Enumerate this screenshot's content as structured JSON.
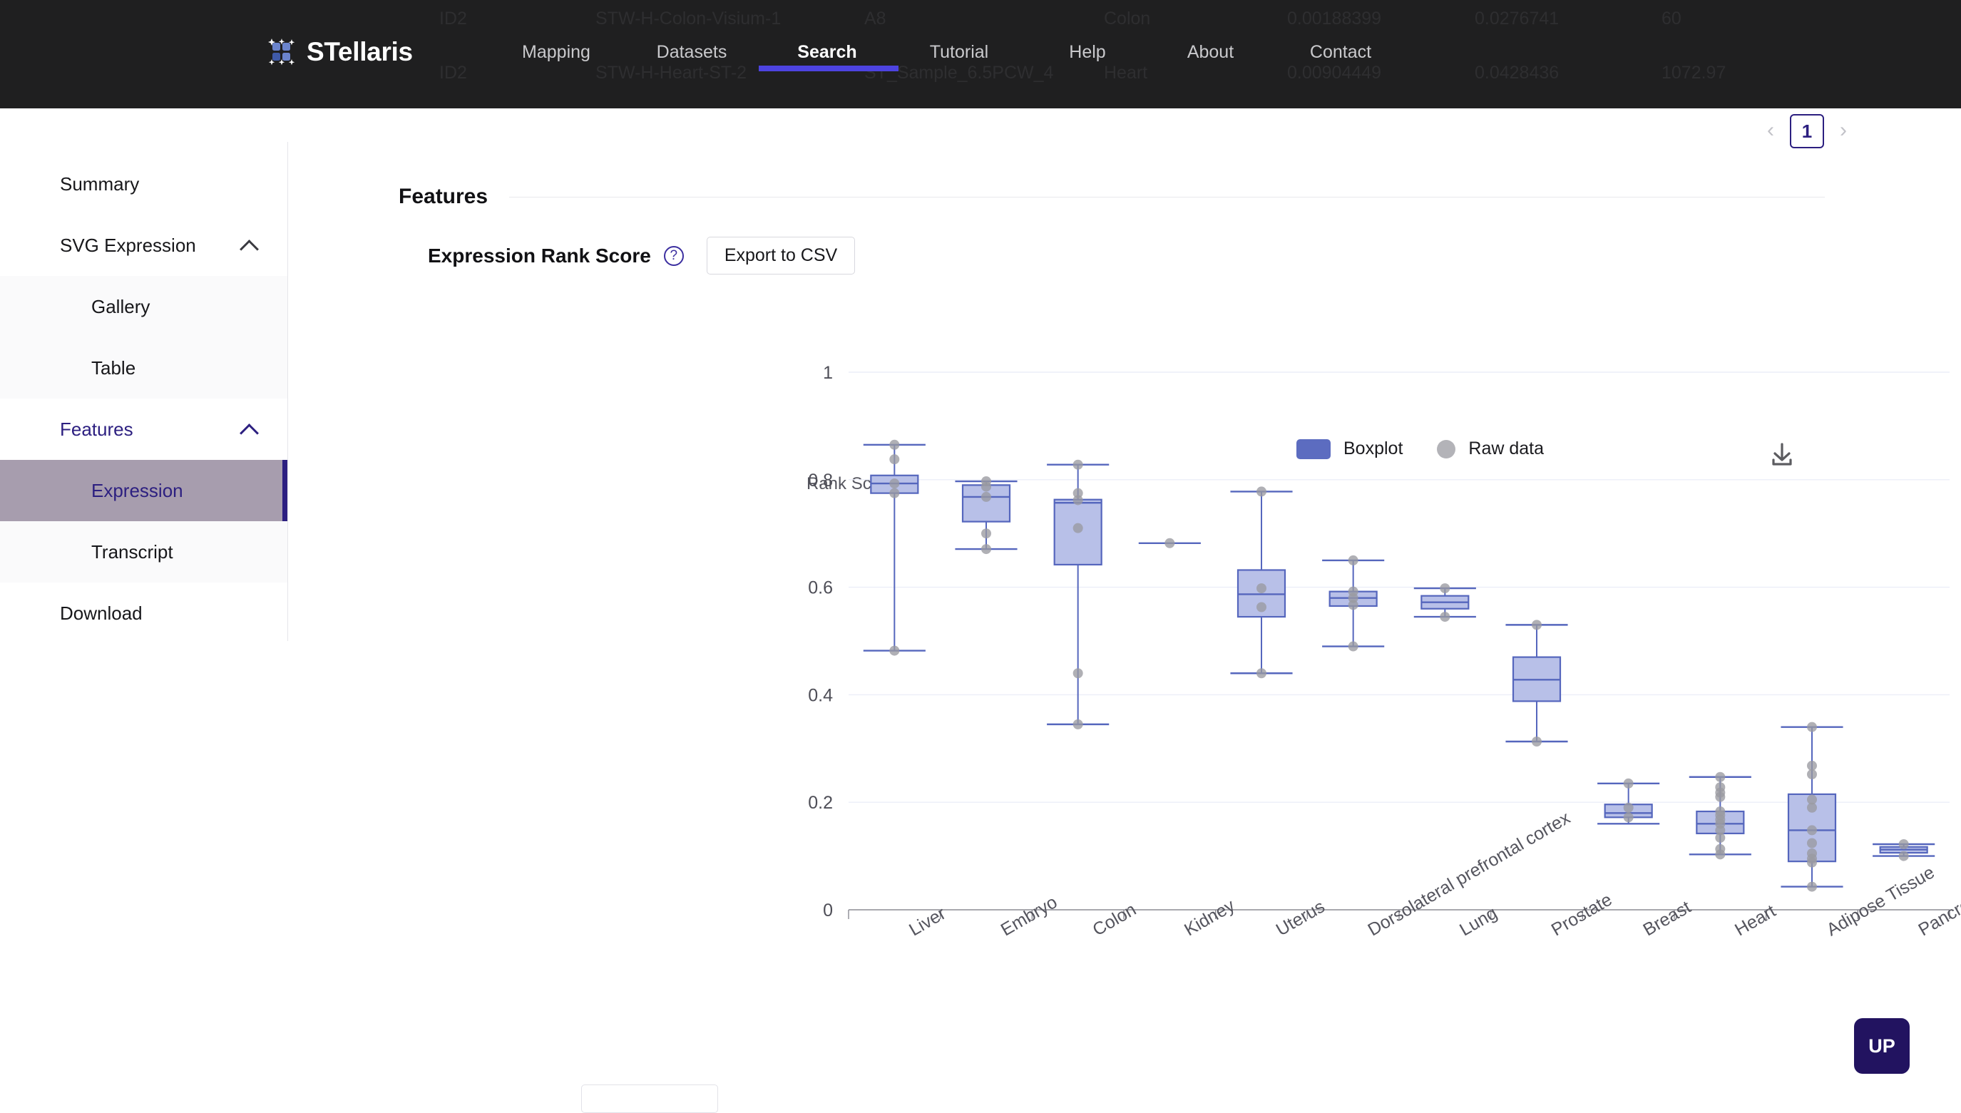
{
  "header": {
    "brand": "STellaris",
    "logo_icon": "grid-sparkle-logo-icon",
    "nav": [
      {
        "label": "Mapping",
        "active": false
      },
      {
        "label": "Datasets",
        "active": false
      },
      {
        "label": "Search",
        "active": true
      },
      {
        "label": "Tutorial",
        "active": false
      },
      {
        "label": "Help",
        "active": false
      },
      {
        "label": "About",
        "active": false
      },
      {
        "label": "Contact",
        "active": false
      }
    ],
    "accent_underline_color": "#4d43e0",
    "background_color": "#1f1f20",
    "ghost_rows": [
      [
        "ID2",
        "STW-H-Colon-Visium-1",
        "A8",
        "Colon",
        "0.00188399",
        "0.0276741",
        "60"
      ],
      [
        "ID2",
        "STW-H-Heart-ST-2",
        "ST_Sample_6.5PCW_4",
        "Heart",
        "0.00904449",
        "0.0428436",
        "1072.97"
      ]
    ]
  },
  "pagination": {
    "prev_icon": "chevron-left-icon",
    "next_icon": "chevron-right-icon",
    "current_page": "1"
  },
  "sidebar": {
    "items": [
      {
        "label": "Summary",
        "type": "item"
      },
      {
        "label": "SVG Expression",
        "type": "group",
        "expanded": true,
        "chevron": "chevron-up-icon"
      },
      {
        "label": "Gallery",
        "type": "sub"
      },
      {
        "label": "Table",
        "type": "sub"
      },
      {
        "label": "Features",
        "type": "group",
        "expanded": true,
        "chevron": "chevron-up-icon"
      },
      {
        "label": "Expression",
        "type": "sub",
        "selected": true
      },
      {
        "label": "Transcript",
        "type": "sub"
      },
      {
        "label": "Download",
        "type": "item"
      }
    ],
    "selected_bg": "#a79dae",
    "selected_accent": "#2c1f80"
  },
  "main": {
    "section_title": "Features",
    "panel_title": "Expression Rank Score",
    "help_icon": "question-mark-circle-icon",
    "export_button": "Export to CSV",
    "download_icon": "download-icon",
    "scroll_top_button": "UP"
  },
  "legend": {
    "boxplot_label": "Boxplot",
    "boxplot_color": "#5c6cc0",
    "rawdata_label": "Raw data",
    "rawdata_color": "#b3b3b8"
  },
  "chart_data": {
    "type": "box",
    "title": "Expression Rank Score",
    "xlabel": "",
    "ylabel": "Rank Score",
    "ylim": [
      0,
      1
    ],
    "ytick_labels": [
      "1",
      "0.8",
      "0.6",
      "0.4",
      "0.2",
      "0"
    ],
    "ytick_values": [
      1,
      0.8,
      0.6,
      0.4,
      0.2,
      0
    ],
    "grid": true,
    "legend_position": "top-center",
    "xtick_rotation": -30,
    "box_fill": "#b8c0e8",
    "box_stroke": "#5566bd",
    "point_color": "#9a9aa0",
    "categories": [
      "Liver",
      "Embryo",
      "Colon",
      "Kidney",
      "Uterus",
      "Dorsolateral prefrontal cortex",
      "Lung",
      "Prostate",
      "Breast",
      "Heart",
      "Adipose Tissue",
      "Pancreas"
    ],
    "boxes": [
      {
        "category": "Liver",
        "min": 0.482,
        "q1": 0.775,
        "median": 0.793,
        "q3": 0.808,
        "max": 0.865,
        "points": [
          0.865,
          0.838,
          0.793,
          0.775,
          0.482
        ]
      },
      {
        "category": "Embryo",
        "min": 0.671,
        "q1": 0.722,
        "median": 0.768,
        "q3": 0.79,
        "max": 0.797,
        "points": [
          0.797,
          0.787,
          0.768,
          0.7,
          0.671
        ]
      },
      {
        "category": "Colon",
        "min": 0.345,
        "q1": 0.642,
        "median": 0.757,
        "q3": 0.763,
        "max": 0.828,
        "points": [
          0.828,
          0.775,
          0.762,
          0.71,
          0.44,
          0.345
        ]
      },
      {
        "category": "Kidney",
        "min": 0.682,
        "q1": 0.682,
        "median": 0.682,
        "q3": 0.682,
        "max": 0.682,
        "points": [
          0.682
        ]
      },
      {
        "category": "Uterus",
        "min": 0.44,
        "q1": 0.545,
        "median": 0.587,
        "q3": 0.632,
        "max": 0.778,
        "points": [
          0.778,
          0.598,
          0.563,
          0.44
        ]
      },
      {
        "category": "Dorsolateral prefrontal cortex",
        "min": 0.49,
        "q1": 0.565,
        "median": 0.58,
        "q3": 0.592,
        "max": 0.65,
        "points": [
          0.65,
          0.592,
          0.58,
          0.567,
          0.49
        ]
      },
      {
        "category": "Lung",
        "min": 0.545,
        "q1": 0.56,
        "median": 0.572,
        "q3": 0.584,
        "max": 0.598,
        "points": [
          0.598,
          0.545
        ]
      },
      {
        "category": "Prostate",
        "min": 0.313,
        "q1": 0.388,
        "median": 0.428,
        "q3": 0.47,
        "max": 0.53,
        "points": [
          0.53,
          0.313
        ]
      },
      {
        "category": "Breast",
        "min": 0.16,
        "q1": 0.172,
        "median": 0.18,
        "q3": 0.196,
        "max": 0.235,
        "points": [
          0.235,
          0.19,
          0.172
        ]
      },
      {
        "category": "Heart",
        "min": 0.103,
        "q1": 0.142,
        "median": 0.16,
        "q3": 0.183,
        "max": 0.247,
        "points": [
          0.247,
          0.228,
          0.218,
          0.21,
          0.183,
          0.176,
          0.168,
          0.16,
          0.148,
          0.134,
          0.113,
          0.103
        ]
      },
      {
        "category": "Adipose Tissue",
        "min": 0.043,
        "q1": 0.09,
        "median": 0.148,
        "q3": 0.215,
        "max": 0.34,
        "points": [
          0.34,
          0.268,
          0.252,
          0.205,
          0.19,
          0.148,
          0.124,
          0.105,
          0.095,
          0.088,
          0.043
        ]
      },
      {
        "category": "Pancreas",
        "min": 0.1,
        "q1": 0.106,
        "median": 0.112,
        "q3": 0.117,
        "max": 0.122,
        "points": [
          0.122,
          0.1
        ]
      }
    ]
  }
}
